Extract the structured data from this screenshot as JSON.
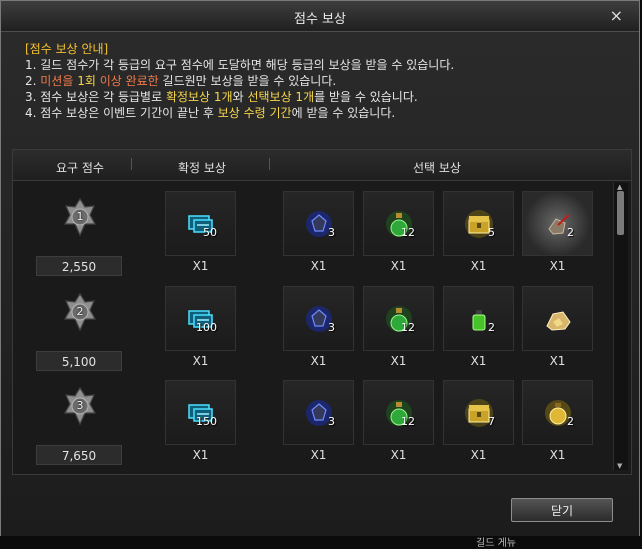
{
  "window": {
    "title": "점수 보상",
    "close_glyph": "×",
    "close_button": "닫기"
  },
  "info": {
    "heading": "[점수 보상 안내]",
    "line1": "1. 길드 점수가 각 등급의 요구 점수에 도달하면 해당 등급의 보상을 받을 수 있습니다.",
    "line2": {
      "prefix": "2. ",
      "hl_a": "미션을 ",
      "hl_b": "1회",
      "hl_c": " 이상 완료한",
      "rest": " 길드원만 보상을 받을 수 있습니다."
    },
    "line3": {
      "prefix": "3. 점수 보상은 각 등급별로 ",
      "hl_a": "확정보상 1개",
      "mid": "와 ",
      "hl_b": "선택보상 1개",
      "rest": "를 받을 수 있습니다."
    },
    "line4": {
      "prefix": "4. 점수 보상은 이벤트 기간이 끝난 후 ",
      "hl": "보상 수령 기간",
      "rest": "에 받을 수 있습니다."
    }
  },
  "table": {
    "headers": {
      "score": "요구 점수",
      "fixed": "확정 보상",
      "select": "선택 보상"
    },
    "rows": [
      {
        "grade": "1",
        "score": "2,550",
        "fixed": {
          "icon": "ticket-icon",
          "count": "50",
          "qty": "X1"
        },
        "select": [
          {
            "icon": "blue-gem-icon",
            "count": "3",
            "qty": "X1"
          },
          {
            "icon": "green-potion-icon",
            "count": "12",
            "qty": "X1"
          },
          {
            "icon": "gold-chest-icon",
            "count": "5",
            "qty": "X1"
          },
          {
            "icon": "stone-arrow-icon",
            "count": "2",
            "qty": "X1"
          }
        ]
      },
      {
        "grade": "2",
        "score": "5,100",
        "fixed": {
          "icon": "ticket-icon",
          "count": "100",
          "qty": "X1"
        },
        "select": [
          {
            "icon": "blue-gem-icon",
            "count": "3",
            "qty": "X1"
          },
          {
            "icon": "green-potion-icon",
            "count": "12",
            "qty": "X1"
          },
          {
            "icon": "green-bottle-icon",
            "count": "2",
            "qty": "X1"
          },
          {
            "icon": "gold-ore-icon",
            "count": "",
            "qty": "X1"
          }
        ]
      },
      {
        "grade": "3",
        "score": "7,650",
        "fixed": {
          "icon": "ticket-icon",
          "count": "150",
          "qty": "X1"
        },
        "select": [
          {
            "icon": "blue-gem-icon",
            "count": "3",
            "qty": "X1"
          },
          {
            "icon": "green-potion-icon",
            "count": "12",
            "qty": "X1"
          },
          {
            "icon": "gold-chest-icon",
            "count": "7",
            "qty": "X1"
          },
          {
            "icon": "gold-lamp-icon",
            "count": "2",
            "qty": "X1"
          }
        ]
      }
    ]
  },
  "footer": {
    "partial_text": "길드 게뉴"
  }
}
